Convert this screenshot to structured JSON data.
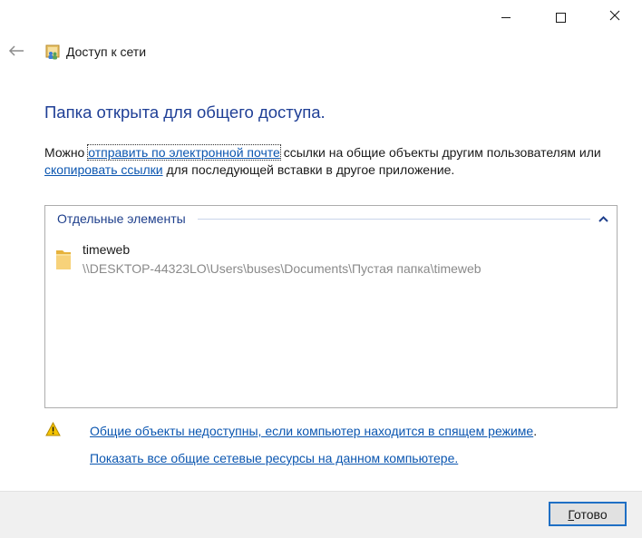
{
  "window": {
    "title": "Доступ к сети"
  },
  "icons": {
    "back": "back-arrow-icon",
    "title": "network-share-icon",
    "minimize": "minimize-icon",
    "maximize": "maximize-icon",
    "close": "close-icon",
    "collapse": "chevron-up-icon",
    "folder": "folder-icon",
    "warning": "warning-icon"
  },
  "main": {
    "headline": "Папка открыта для общего доступа.",
    "paragraph": {
      "prefix": "Можно ",
      "email_link": "отправить по электронной почте",
      "middle": " ссылки на общие объекты другим пользователям или ",
      "copy_link": "скопировать ссылки",
      "suffix": " для последующей вставки в другое приложение."
    }
  },
  "items_panel": {
    "group_header": "Отдельные элементы",
    "items": [
      {
        "name": "timeweb",
        "path": "\\\\DESKTOP-44323LO\\Users\\buses\\Documents\\Пустая папка\\timeweb"
      }
    ]
  },
  "links": {
    "sleep_notice": "Общие объекты недоступны, если компьютер находится в спящем режиме",
    "sleep_punct": ".",
    "show_all": "Показать все общие сетевые ресурсы на данном компьютере."
  },
  "footer": {
    "done_accel": "Г",
    "done_rest": "отово"
  },
  "colors": {
    "headline": "#1f3f96",
    "link": "#0b56b0",
    "path_gray": "#8a8a8a",
    "button_border": "#1f6fc4",
    "footer_bg": "#f0f0f0"
  }
}
